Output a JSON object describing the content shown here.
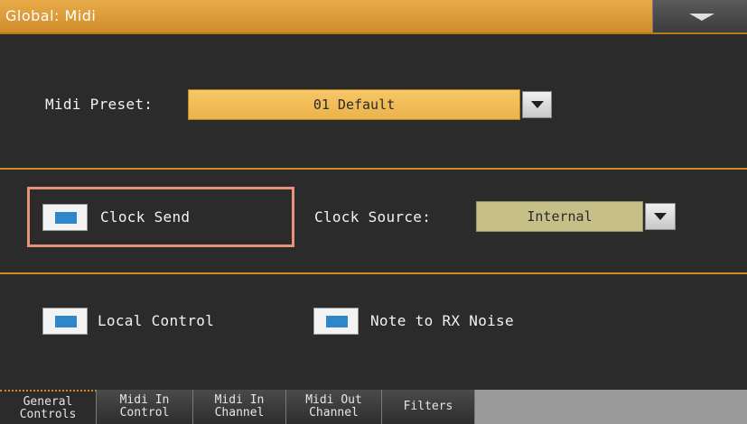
{
  "header": {
    "title": "Global: Midi",
    "menu_icon": "dropdown-triangle-icon"
  },
  "preset": {
    "label": "Midi Preset:",
    "value": "01 Default"
  },
  "clock": {
    "send_label": "Clock Send",
    "send_checked": true,
    "source_label": "Clock Source:",
    "source_value": "Internal"
  },
  "options": {
    "local_control_label": "Local Control",
    "local_control_checked": true,
    "note_rx_noise_label": "Note to RX Noise",
    "note_rx_noise_checked": true
  },
  "tabs": [
    {
      "line1": "General",
      "line2": "Controls",
      "active": true
    },
    {
      "line1": "Midi In",
      "line2": "Control",
      "active": false
    },
    {
      "line1": "Midi In",
      "line2": "Channel",
      "active": false
    },
    {
      "line1": "Midi Out",
      "line2": "Channel",
      "active": false
    },
    {
      "line1": "Filters",
      "line2": "",
      "active": false
    }
  ],
  "colors": {
    "title_bar": "#d99a36",
    "accent_line": "#d78a23",
    "preset_field": "#f2bd5a",
    "source_field": "#c7bf88",
    "checkbox_fill": "#2f86c9",
    "highlight": "#e8927a"
  }
}
